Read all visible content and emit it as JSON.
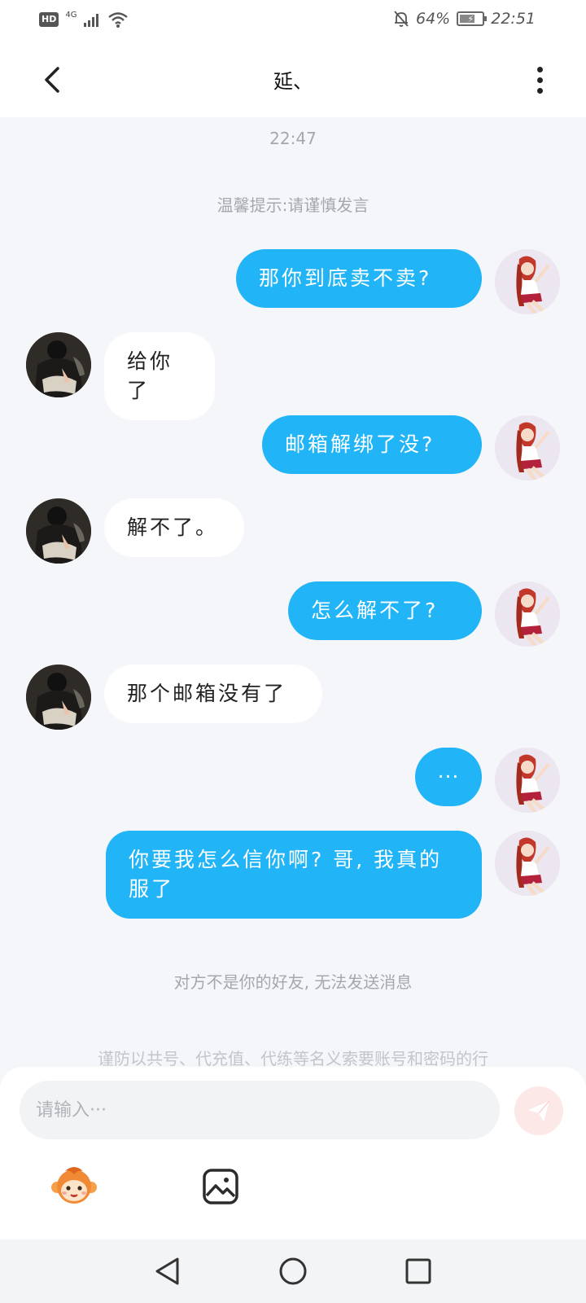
{
  "status_bar": {
    "hd_badge": "HD",
    "network": "4G",
    "battery": "64%",
    "time": "22:51"
  },
  "header": {
    "title": "延、"
  },
  "chat": {
    "timestamp": "22:47",
    "notice": "温馨提示:请谨慎发言",
    "messages": [
      {
        "side": "out",
        "text": "那你到底卖不卖?"
      },
      {
        "side": "in",
        "text": "给你了"
      },
      {
        "side": "out",
        "text": "邮箱解绑了没?"
      },
      {
        "side": "in",
        "text": "解不了。"
      },
      {
        "side": "out",
        "text": "怎么解不了?"
      },
      {
        "side": "in",
        "text": "那个邮箱没有了"
      },
      {
        "side": "out",
        "text": "···"
      },
      {
        "side": "out",
        "text": "你要我怎么信你啊? 哥, 我真的服了"
      }
    ],
    "system_message": "对方不是你的好友, 无法发送消息",
    "warning": "谨防以共号、代充值、代练等名义索要账号和密码的行"
  },
  "input": {
    "placeholder": "请输入···"
  },
  "colors": {
    "accent": "#21b4f6",
    "background": "#f4f6f9"
  }
}
